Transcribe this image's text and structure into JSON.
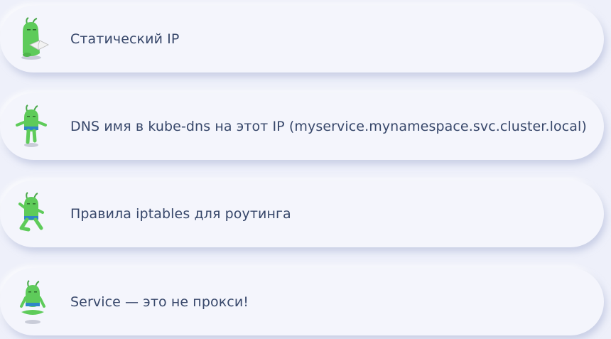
{
  "items": [
    {
      "label": "Статический IP",
      "icon": "reading-mascot-icon"
    },
    {
      "label": "DNS имя в kube-dns на этот IP (myservice.mynamespace.svc.cluster.local)",
      "icon": "standing-mascot-icon"
    },
    {
      "label": "Правила iptables для роутинга",
      "icon": "yoga-mascot-icon"
    },
    {
      "label": "Service — это не прокси!",
      "icon": "meditating-mascot-icon"
    }
  ],
  "colors": {
    "background": "#eef0fa",
    "card": "#f4f5fc",
    "text": "#37476a",
    "mascot_green": "#5ecb5a",
    "mascot_belt": "#2f86c8"
  }
}
